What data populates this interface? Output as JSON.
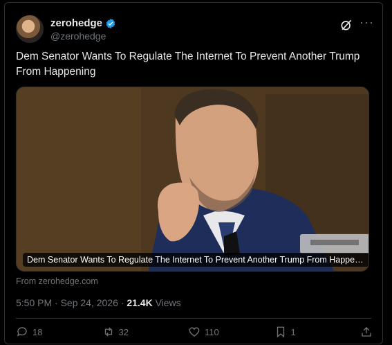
{
  "author": {
    "display_name": "zerohedge",
    "handle": "@zerohedge",
    "verified_color": "#1d9bf0"
  },
  "tweet": {
    "text": "Dem Senator Wants To Regulate The Internet To Prevent Another Trump From Happening",
    "media_caption": "Dem Senator Wants To Regulate The Internet To Prevent Another Trump From Happeni...",
    "source": "From zerohedge.com",
    "timestamp": "5:50 PM · Sep 24, 2026 · ",
    "views_count": "21.4K",
    "views_label": " Views"
  },
  "actions": {
    "replies": "18",
    "reposts": "32",
    "likes": "110",
    "bookmarks": "1"
  },
  "icons": [
    "verified-icon",
    "grok-icon",
    "more-icon",
    "reply-icon",
    "repost-icon",
    "like-icon",
    "bookmark-icon",
    "share-icon"
  ],
  "colors": {
    "background": "#000000",
    "text": "#e7e9ea",
    "muted": "#71767b",
    "accent": "#1d9bf0"
  }
}
